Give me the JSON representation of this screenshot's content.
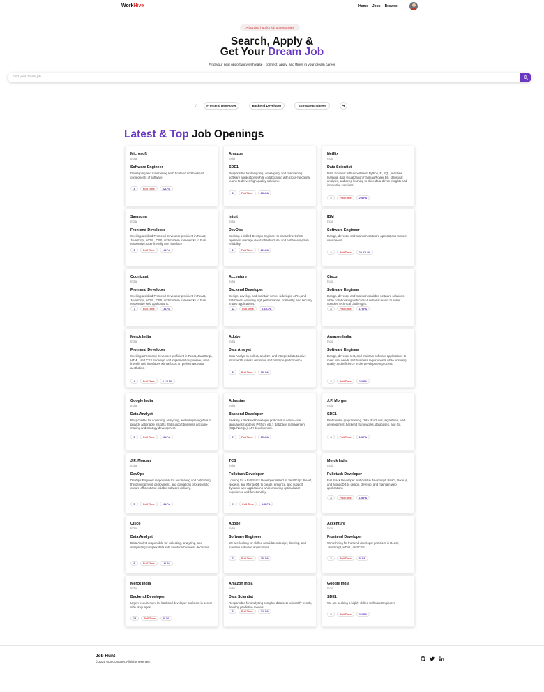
{
  "nav": {
    "logo_part1": "Work",
    "logo_part2": "Hive",
    "links": [
      "Home",
      "Jobs",
      "Browse"
    ]
  },
  "hero": {
    "tagline": "A buzzing hub for job opportunities",
    "title_line1": "Search, Apply &",
    "title_line2_prefix": "Get Your ",
    "title_line2_highlight": "Dream Job",
    "subtitle": "Find your next opportunity with ease - connect, apply, and thrive in your dream career",
    "search_placeholder": "Find your dream job"
  },
  "categories": [
    "Frontend Developer",
    "Backend Developer",
    "Software Engineer"
  ],
  "section": {
    "title_highlight": "Latest & Top",
    "title_rest": " Job Openings"
  },
  "jobs": [
    {
      "company": "Microsoft",
      "location": "India",
      "title": "Software Engineer",
      "description": "Developing and maintaining both frontend and backend components of software",
      "positions": "4",
      "type": "Full Time",
      "salary": "32LPA"
    },
    {
      "company": "Amazon",
      "location": "India",
      "title": "SDE1",
      "description": "Responsible for designing, developing, and maintaining software applications while collaborating with cross-functional teams to deliver high-quality solutions.",
      "positions": "6",
      "type": "Full Time",
      "salary": "28LPA"
    },
    {
      "company": "Netflix",
      "location": "India",
      "title": "Data Scientist",
      "description": "Data Scientist with expertise in Python, R, SQL, machine learning, data visualization (Tableau/Power BI), statistical analysis, and deep learning to drive data-driven insights and innovative solutions.",
      "positions": "2",
      "type": "Full Time",
      "salary": "20LPA"
    },
    {
      "company": "Samsung",
      "location": "India",
      "title": "Frontend Developer",
      "description": "Seeking a skilled Frontend Developer proficient in React, JavaScript, HTML, CSS, and modern frameworks to build responsive, user-friendly user interface",
      "positions": "3",
      "type": "Full Time",
      "salary": "16LPA"
    },
    {
      "company": "Intuit",
      "location": "India",
      "title": "DevOps",
      "description": "Seeking a skilled DevOps Engineer to streamline CI/CD pipelines, manage cloud infrastructure, and enhance system reliability.",
      "positions": "2",
      "type": "Full Time",
      "salary": "22LPA"
    },
    {
      "company": "IBM",
      "location": "India",
      "title": "Software Engineer",
      "description": "Design, develop, and maintain software applications to meet user needs",
      "positions": "3",
      "type": "Full Time",
      "salary": "25.42LPA"
    },
    {
      "company": "Cognizant",
      "location": "India",
      "title": "Frontend Developer",
      "description": "Seeking a skilled Frontend Developer proficient in React, JavaScript, HTML, CSS, and modern frameworks to build responsive web applications.",
      "positions": "7",
      "type": "Full Time",
      "salary": "16LPA"
    },
    {
      "company": "Accenture",
      "location": "India",
      "title": "Backend Developer",
      "description": "Design, develop, and maintain server-side logic, APIs, and databases, ensuring high performance, scalability, and security in web applications.",
      "positions": "12",
      "type": "Full Time",
      "salary": "8.33LPA"
    },
    {
      "company": "Cisco",
      "location": "India",
      "title": "Software Engineer",
      "description": "Design, develop, and maintain scalable software solutions while collaborating with cross-functional teams to solve complex technical challenges.",
      "positions": "4",
      "type": "Full Time",
      "salary": "17LPA"
    },
    {
      "company": "Merck India",
      "location": "India",
      "title": "Frontend Developer",
      "description": "Seeking a Frontend Developer proficient in React, JavaScript, HTML, and CSS to design and implement responsive, user-friendly web interfaces with a focus on performance and aesthetics.",
      "positions": "4",
      "type": "Full Time",
      "salary": "5.12LPA"
    },
    {
      "company": "Adobe",
      "location": "India",
      "title": "Data Analyst",
      "description": "Data Analyst to collect, analyze, and interpret data to drive informed business decisions and optimize performance.",
      "positions": "8",
      "type": "Full Time",
      "salary": "18LPA"
    },
    {
      "company": "Amazon India",
      "location": "India",
      "title": "Software Engineer",
      "description": "Design, develop, test, and maintain software applications to meet user needs and business requirements while ensuring quality and efficiency in the development process.",
      "positions": "3",
      "type": "Full Time",
      "salary": "26LPA"
    },
    {
      "company": "Google India",
      "location": "India",
      "title": "Data Analyst",
      "description": "Responsible for collecting, analyzing, and interpreting data to provide actionable insights that support business decision-making and strategy development.",
      "positions": "5",
      "type": "Full Time",
      "salary": "50LPA"
    },
    {
      "company": "Atlassian",
      "location": "India",
      "title": "Backend Developer",
      "description": "Seeking a Backend Developer proficient in server-side languages (Node.js, Python, etc.), database management (SQL/NoSQL), API development.",
      "positions": "7",
      "type": "Full Time",
      "salary": "15LPA"
    },
    {
      "company": "J.P. Morgan",
      "location": "India",
      "title": "SDE1",
      "description": "Proficient in programming, data structures, algorithms, web development, backend frameworks, databases, and Git.",
      "positions": "3",
      "type": "Full Time",
      "salary": "18LPA"
    },
    {
      "company": "J.P. Morgan",
      "location": "India",
      "title": "DevOps",
      "description": "DevOps Engineer responsible for automating and optimizing the development, deployment, and operations processes to ensure efficient and reliable software delivery.",
      "positions": "5",
      "type": "Full Time",
      "salary": "22LPA"
    },
    {
      "company": "TCS",
      "location": "India",
      "title": "Fullstack Developer",
      "description": "Looking for a Full Stack Developer skilled in JavaScript, React, Node.js, and MongoDB to create, enhance, and support dynamic web applications while ensuring optimal user experience and functionality.",
      "positions": "21",
      "type": "Full Time",
      "salary": "4.5LPA"
    },
    {
      "company": "Merck India",
      "location": "India",
      "title": "Fullstack Developer",
      "description": "Full Stack Developer proficient in JavaScript, React, Node.js, and MongoDB to design, develop, and maintain web applications",
      "positions": "4",
      "type": "Full Time",
      "salary": "15LPA"
    },
    {
      "company": "Cisco",
      "location": "India",
      "title": "Data Analyst",
      "description": "Data Analyst responsible for collecting, analyzing, and interpreting complex data sets to inform business decisions.",
      "positions": "6",
      "type": "Full Time",
      "salary": "16LPA"
    },
    {
      "company": "Adobe",
      "location": "India",
      "title": "Software Engineer",
      "description": "We are looking for skilled candidates design, develop, and maintain software applications.",
      "positions": "2",
      "type": "Full Time",
      "salary": "28LPA"
    },
    {
      "company": "Accenture",
      "location": "India",
      "title": "Frontend Developer",
      "description": "We're hiring for frontend developer proficient in React, JavaScript, HTML, and CSS",
      "positions": "3",
      "type": "Full Time",
      "salary": "9LPA"
    },
    {
      "company": "Merck India",
      "location": "India",
      "title": "Backend Developer",
      "description": "Urgent requirement for backend developer proficient in server-side languages",
      "positions": "12",
      "type": "Full Time",
      "salary": "8LPA"
    },
    {
      "company": "Amazon India",
      "location": "India",
      "title": "Data Scientist",
      "description": "Responsible for analyzing complex data sets to identify trends, develop predictive models.",
      "positions": "3",
      "type": "Full Time",
      "salary": "24LPA"
    },
    {
      "company": "Google India",
      "location": "India",
      "title": "SDE1",
      "description": "We are seeking a highly skilled Software Engineers",
      "positions": "5",
      "type": "Full Time",
      "salary": "36LPA"
    }
  ],
  "footer": {
    "title": "Job Hunt",
    "copyright": "© 2024 Your Company. All rights reserved."
  },
  "colors": {
    "brand_purple": "#6a38c2",
    "brand_red": "#d93636"
  },
  "icons": [
    "search-icon",
    "chevron-left-icon",
    "chevron-right-icon",
    "github-icon",
    "twitter-icon",
    "linkedin-icon"
  ]
}
